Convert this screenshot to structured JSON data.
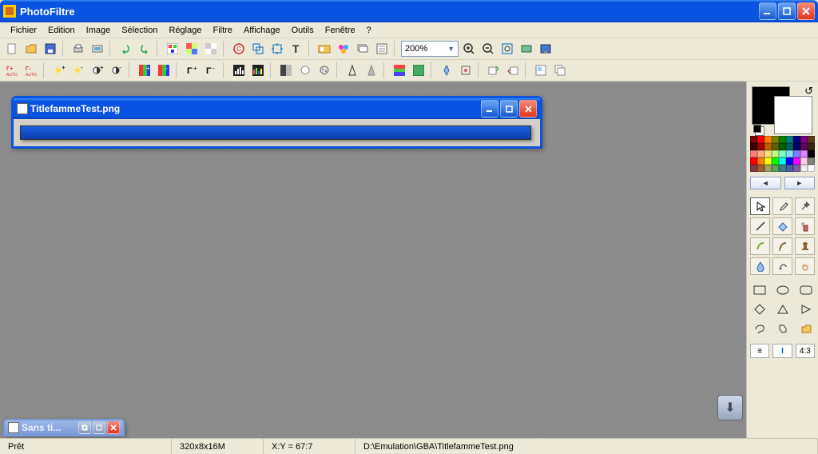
{
  "app": {
    "title": "PhotoFiltre"
  },
  "menu": [
    "Fichier",
    "Edition",
    "Image",
    "Sélection",
    "Réglage",
    "Filtre",
    "Affichage",
    "Outils",
    "Fenêtre",
    "?"
  ],
  "zoom": "200%",
  "doc_active": {
    "title": "TitlefammeTest.png"
  },
  "doc_inactive": {
    "title": "Sans ti..."
  },
  "status": {
    "ready": "Prêt",
    "dims": "320x8x16M",
    "xy": "X:Y = 67:7",
    "path": "D:\\Emulation\\GBA\\TitlefammeTest.png"
  },
  "palette_colors": [
    "#800000",
    "#ff0000",
    "#ff8000",
    "#808000",
    "#008000",
    "#008080",
    "#000080",
    "#800080",
    "#5a3a1c",
    "#400000",
    "#a00000",
    "#c06000",
    "#606000",
    "#006000",
    "#006060",
    "#000060",
    "#600060",
    "#3a2412",
    "#ff8080",
    "#ffb080",
    "#ffe080",
    "#c0ff80",
    "#80ffc0",
    "#80e0ff",
    "#8080ff",
    "#e080ff",
    "#000000",
    "#ff0000",
    "#ff8000",
    "#ffff00",
    "#00ff00",
    "#00ffff",
    "#0000ff",
    "#ff00ff",
    "#ffd0e0",
    "#808080",
    "#804040",
    "#a06030",
    "#a0a060",
    "#60a060",
    "#408080",
    "#4060a0",
    "#8060a0",
    "#f0f0f0",
    "#ffffff"
  ],
  "opt_row": [
    "≡",
    "I",
    "4:3"
  ]
}
